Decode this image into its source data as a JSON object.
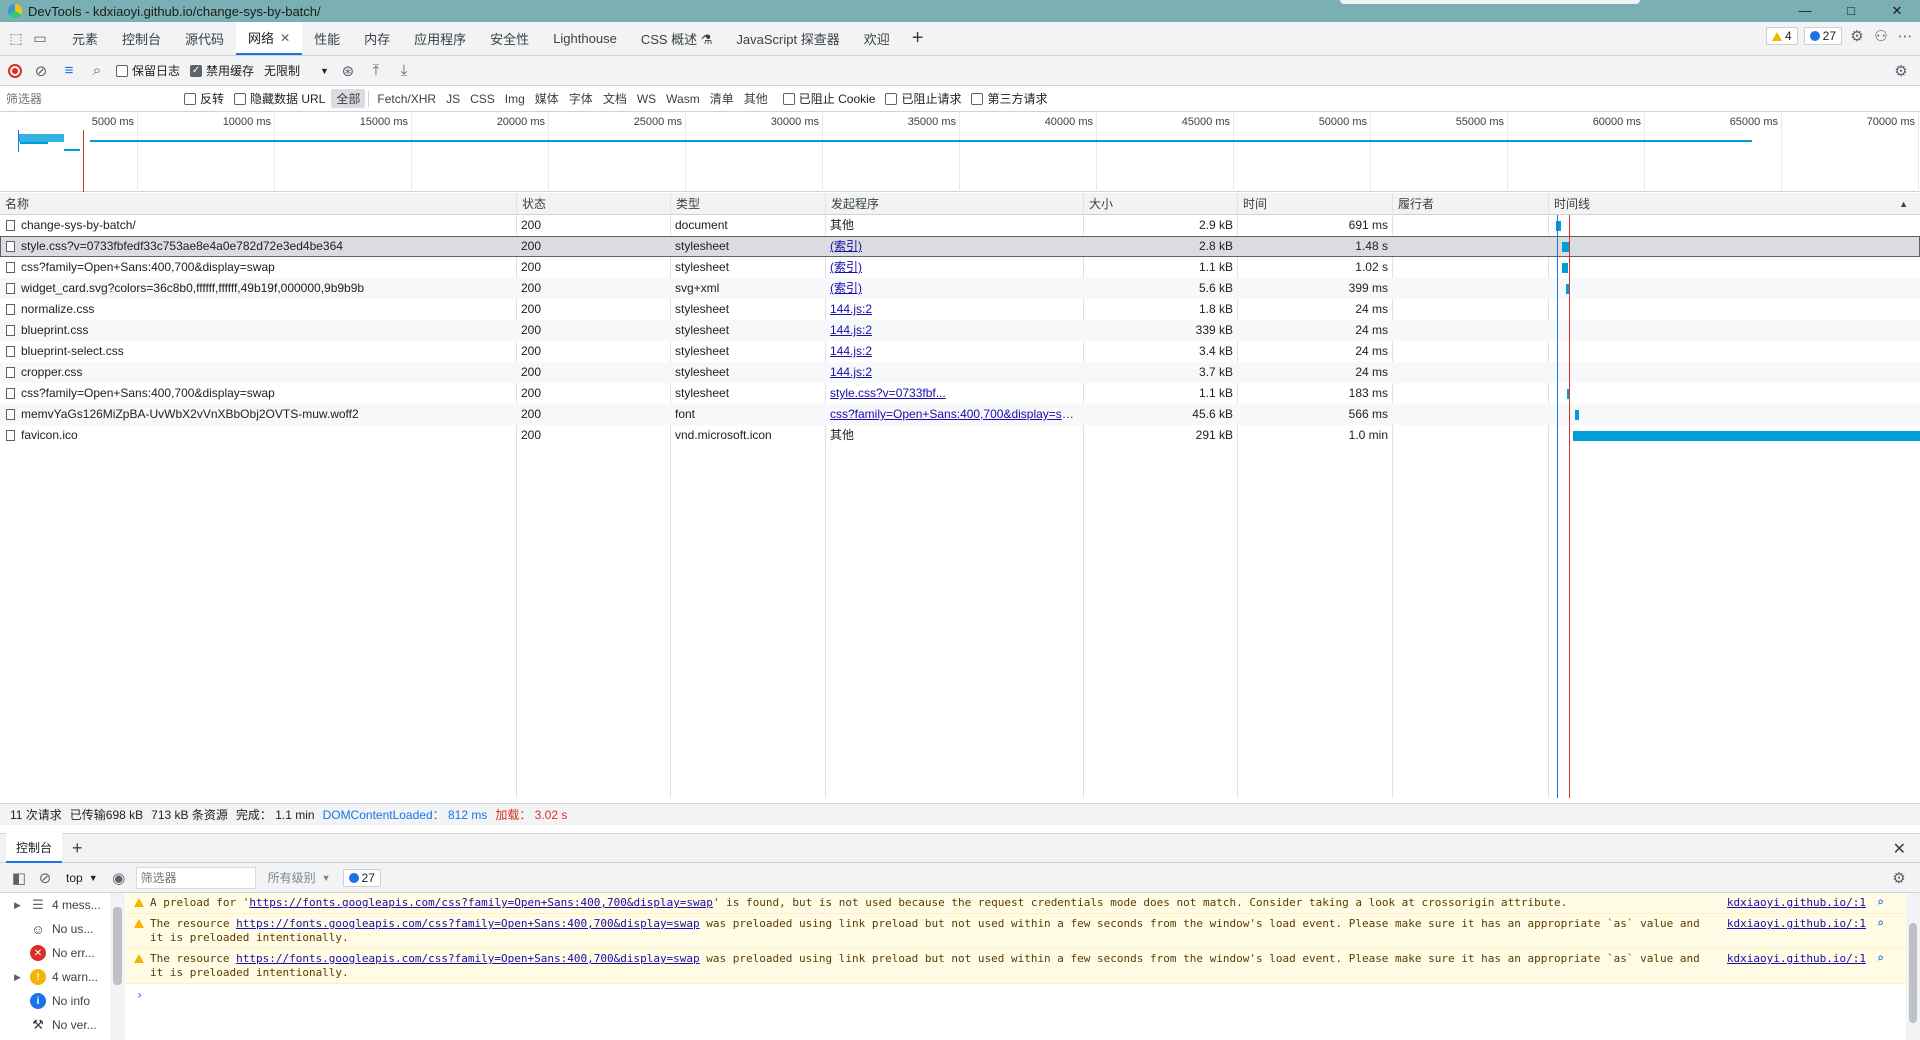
{
  "window": {
    "title": "DevTools - kdxiaoyi.github.io/change-sys-by-batch/",
    "controls": [
      "—",
      "□",
      "✕"
    ]
  },
  "panel_tabs": [
    {
      "label": "元素"
    },
    {
      "label": "控制台"
    },
    {
      "label": "源代码"
    },
    {
      "label": "网络",
      "active": true
    },
    {
      "label": "性能"
    },
    {
      "label": "内存"
    },
    {
      "label": "应用程序"
    },
    {
      "label": "安全性"
    },
    {
      "label": "Lighthouse"
    },
    {
      "label": "CSS 概述 ⚗"
    },
    {
      "label": "JavaScript 探查器"
    },
    {
      "label": "欢迎"
    }
  ],
  "badges": {
    "warnings": "4",
    "messages": "27"
  },
  "network_toolbar": {
    "preserve_log": "保留日志",
    "disable_cache": "禁用缓存",
    "throttle": "无限制"
  },
  "filter_bar": {
    "placeholder": "筛选器",
    "invert": "反转",
    "hide_data_urls": "隐藏数据 URL",
    "types": [
      "全部",
      "Fetch/XHR",
      "JS",
      "CSS",
      "Img",
      "媒体",
      "字体",
      "文档",
      "WS",
      "Wasm",
      "清单",
      "其他"
    ],
    "blocked_cookies": "已阻止 Cookie",
    "blocked_requests": "已阻止请求",
    "third_party": "第三方请求"
  },
  "overview_ticks": [
    "5000 ms",
    "10000 ms",
    "15000 ms",
    "20000 ms",
    "25000 ms",
    "30000 ms",
    "35000 ms",
    "40000 ms",
    "45000 ms",
    "50000 ms",
    "55000 ms",
    "60000 ms",
    "65000 ms",
    "70000 ms"
  ],
  "columns": {
    "name": "名称",
    "status": "状态",
    "type": "类型",
    "initiator": "发起程序",
    "size": "大小",
    "time": "时间",
    "fulfilled_by": "履行者",
    "waterfall": "时间线"
  },
  "requests": [
    {
      "name": "change-sys-by-batch/",
      "status": "200",
      "type": "document",
      "initiator": "其他",
      "initiator_link": false,
      "size": "2.9 kB",
      "time": "691 ms"
    },
    {
      "name": "style.css?v=0733fbfedf33c753ae8e4a0e782d72e3ed4be364",
      "status": "200",
      "type": "stylesheet",
      "initiator": "(索引)",
      "initiator_link": true,
      "size": "2.8 kB",
      "time": "1.48 s",
      "selected": true
    },
    {
      "name": "css?family=Open+Sans:400,700&display=swap",
      "status": "200",
      "type": "stylesheet",
      "initiator": "(索引)",
      "initiator_link": true,
      "size": "1.1 kB",
      "time": "1.02 s"
    },
    {
      "name": "widget_card.svg?colors=36c8b0,ffffff,ffffff,49b19f,000000,9b9b9b",
      "status": "200",
      "type": "svg+xml",
      "initiator": "(索引)",
      "initiator_link": true,
      "size": "5.6 kB",
      "time": "399 ms"
    },
    {
      "name": "normalize.css",
      "status": "200",
      "type": "stylesheet",
      "initiator": "144.js:2",
      "initiator_link": true,
      "size": "1.8 kB",
      "time": "24 ms"
    },
    {
      "name": "blueprint.css",
      "status": "200",
      "type": "stylesheet",
      "initiator": "144.js:2",
      "initiator_link": true,
      "size": "339 kB",
      "time": "24 ms"
    },
    {
      "name": "blueprint-select.css",
      "status": "200",
      "type": "stylesheet",
      "initiator": "144.js:2",
      "initiator_link": true,
      "size": "3.4 kB",
      "time": "24 ms"
    },
    {
      "name": "cropper.css",
      "status": "200",
      "type": "stylesheet",
      "initiator": "144.js:2",
      "initiator_link": true,
      "size": "3.7 kB",
      "time": "24 ms"
    },
    {
      "name": "css?family=Open+Sans:400,700&display=swap",
      "status": "200",
      "type": "stylesheet",
      "initiator": "style.css?v=0733fbf...",
      "initiator_link": true,
      "size": "1.1 kB",
      "time": "183 ms"
    },
    {
      "name": "memvYaGs126MiZpBA-UvWbX2vVnXBbObj2OVTS-muw.woff2",
      "status": "200",
      "type": "font",
      "initiator": "css?family=Open+Sans:400,700&display=sw...",
      "initiator_link": true,
      "size": "45.6 kB",
      "time": "566 ms"
    },
    {
      "name": "favicon.ico",
      "status": "200",
      "type": "vnd.microsoft.icon",
      "initiator": "其他",
      "initiator_link": false,
      "size": "291 kB",
      "time": "1.0 min"
    }
  ],
  "summary": {
    "requests": "11 次请求",
    "transferred": "已传输698 kB",
    "resources": "713 kB 条资源",
    "finish": "完成： 1.1 min",
    "dcl": "DOMContentLoaded： 812 ms",
    "load": "加载： 3.02 s"
  },
  "drawer": {
    "tab": "控制台",
    "context": "top",
    "filter_placeholder": "筛选器",
    "levels": "所有级别",
    "msg_count": "27"
  },
  "console_sidebar": [
    {
      "label": "4 mess...",
      "icon": "list-icon",
      "expandable": true
    },
    {
      "label": "No us...",
      "icon": "user-icon",
      "expandable": false
    },
    {
      "label": "No err...",
      "icon": "error-icon",
      "expandable": false
    },
    {
      "label": "4 warn...",
      "icon": "warning-icon",
      "expandable": true
    },
    {
      "label": "No info",
      "icon": "info-icon",
      "expandable": false
    },
    {
      "label": "No ver...",
      "icon": "verbose-icon",
      "expandable": false
    }
  ],
  "console_messages": [
    {
      "pre": "A preload for '",
      "url": "https://fonts.googleapis.com/css?family=Open+Sans:400,700&display=swap",
      "post": "' is found, but is not used because the request credentials mode does not match. Consider taking a look at crossorigin attribute.",
      "source": "kdxiaoyi.github.io/:1"
    },
    {
      "pre": "The resource ",
      "url": "https://fonts.googleapis.com/css?family=Open+Sans:400,700&display=swap",
      "post": " was preloaded using link preload but not used within a few seconds from the window's load event. Please make sure it has an appropriate `as` value and it is preloaded intentionally.",
      "source": "kdxiaoyi.github.io/:1"
    },
    {
      "pre": "The resource ",
      "url": "https://fonts.googleapis.com/css?family=Open+Sans:400,700&display=swap",
      "post": " was preloaded using link preload but not used within a few seconds from the window's load event. Please make sure it has an appropriate `as` value and it is preloaded intentionally.",
      "source": "kdxiaoyi.github.io/:1"
    }
  ],
  "colors": {
    "accent": "#1a73e8",
    "warning_bg": "#fffbe5",
    "waterfall": "#009dd9",
    "dcl_line": "#1a73e8",
    "load_line": "#d93025"
  }
}
